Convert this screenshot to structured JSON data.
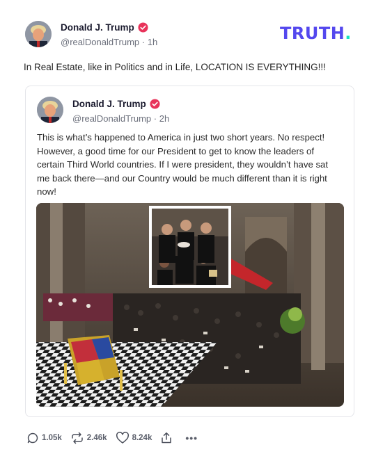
{
  "post": {
    "author_name": "Donald J. Trump",
    "handle": "@realDonaldTrump",
    "separator": "·",
    "time": "1h",
    "text": "In Real Estate, like in Politics and in Life, LOCATION IS EVERYTHING!!!"
  },
  "brand": {
    "logo_text": "TRUTH",
    "logo_dot": ".",
    "logo_color": "#5448ee",
    "logo_dot_color": "#17e3c1"
  },
  "quoted_post": {
    "author_name": "Donald J. Trump",
    "handle": "@realDonaldTrump",
    "separator": "·",
    "time": "2h",
    "text": "This is what’s happened to America in just two short years. No respect! However, a good time for our President to get to know the leaders of certain Third World countries. If I were president, they wouldn’t have sat me back there—and our Country would be much different than it is right now!",
    "image_icon": "cathedral-funeral-photo"
  },
  "actions": {
    "replies": "1.05k",
    "retruths": "2.46k",
    "likes": "8.24k",
    "share_icon": "share-icon",
    "more_label": "•••"
  },
  "colors": {
    "verified_badge": "#e8335a",
    "handle_gray": "#6b6f7b",
    "border": "#e4e5e9"
  }
}
